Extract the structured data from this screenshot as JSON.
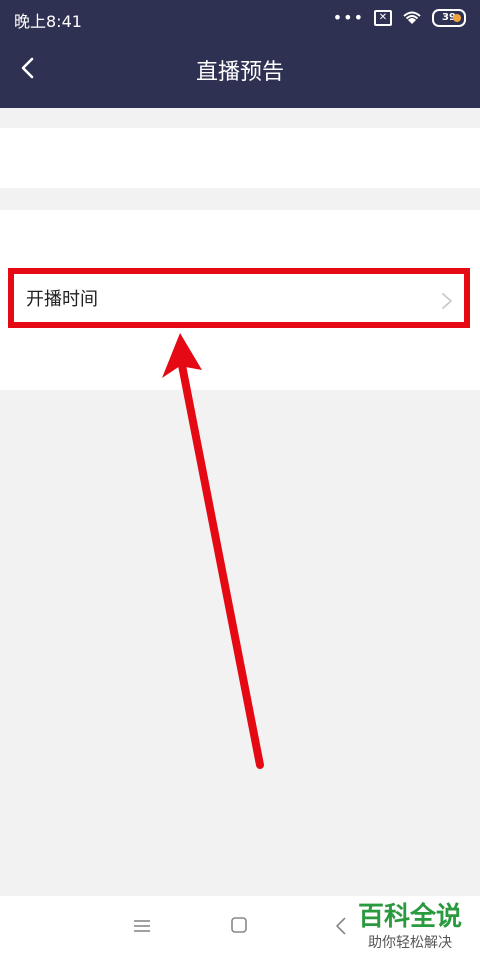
{
  "status_bar": {
    "time": "晚上8:41",
    "dots": "•••",
    "sim_icon_symbol": "✕",
    "battery": "39"
  },
  "header": {
    "title": "直播预告",
    "back_icon": "back-arrow-icon"
  },
  "list": {
    "broadcast_time_label": "开播时间",
    "chevron_icon": "chevron-right-icon"
  },
  "annotation": {
    "highlight_color": "#e50914",
    "arrow_color": "#e50914"
  },
  "nav_bar": {
    "menu_icon": "menu-icon",
    "home_icon": "home-square-icon",
    "back_icon": "back-triangle-icon"
  },
  "watermark": {
    "main": "百科全说",
    "sub": "助你轻松解决"
  },
  "colors": {
    "header_bg": "#2f3153",
    "page_bg": "#f2f2f2",
    "watermark_green": "#2b9a3f"
  }
}
